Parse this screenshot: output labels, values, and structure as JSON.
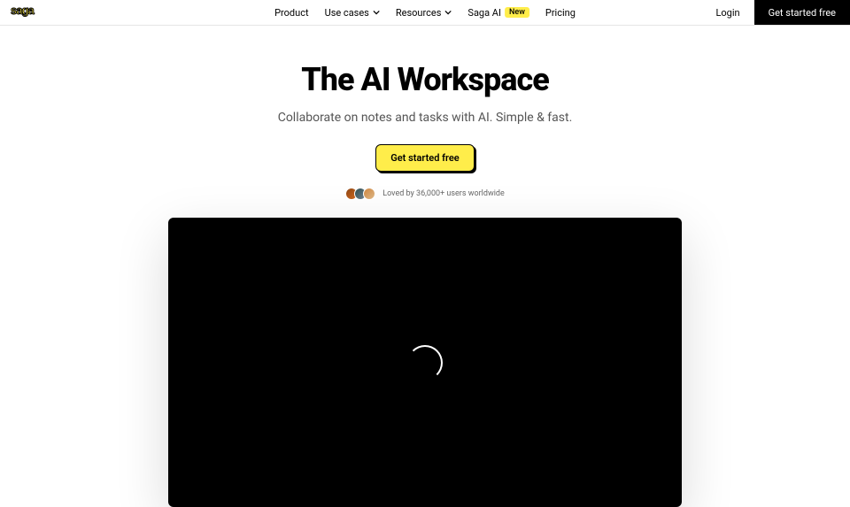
{
  "header": {
    "logo": "saga",
    "nav": {
      "product": "Product",
      "use_cases": "Use cases",
      "resources": "Resources",
      "saga_ai": "Saga AI",
      "new_badge": "New",
      "pricing": "Pricing"
    },
    "login": "Login",
    "cta": "Get started free"
  },
  "hero": {
    "title": "The AI Workspace",
    "subtitle": "Collaborate on notes and tasks with AI. Simple & fast.",
    "cta": "Get started free",
    "social_proof": "Loved by 36,000+ users worldwide"
  }
}
